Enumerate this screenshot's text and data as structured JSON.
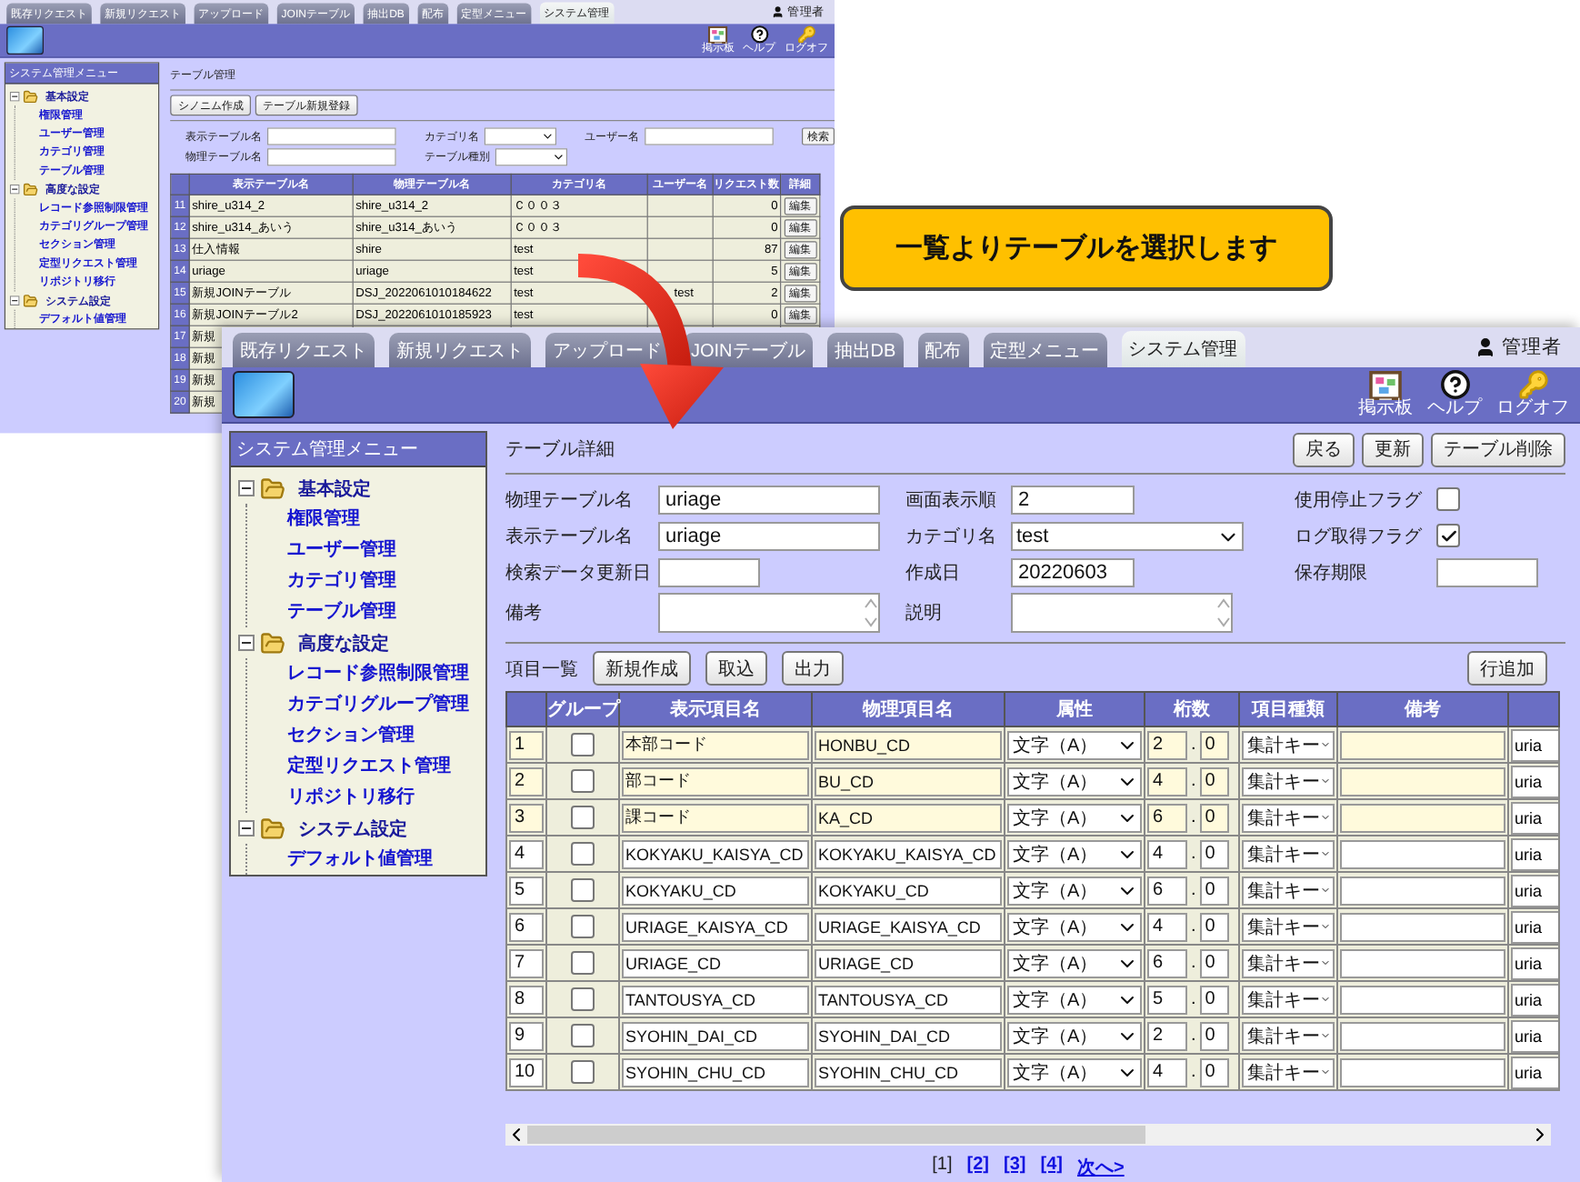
{
  "background_window": {
    "tabs": [
      {
        "label": "既存リクエスト",
        "selected": false
      },
      {
        "label": "新規リクエスト",
        "selected": false
      },
      {
        "label": "アップロード",
        "selected": false
      },
      {
        "label": "JOINテーブル",
        "selected": false
      },
      {
        "label": "抽出DB",
        "selected": false
      },
      {
        "label": "配布",
        "selected": false
      },
      {
        "label": "定型メニュー",
        "selected": false
      },
      {
        "label": "システム管理",
        "selected": true
      }
    ],
    "user": "管理者",
    "header_icons": [
      {
        "kind": "board",
        "label": "掲示板"
      },
      {
        "kind": "help",
        "label": "ヘルプ"
      },
      {
        "kind": "logoff",
        "label": "ログオフ"
      }
    ],
    "menu": {
      "title": "システム管理メニュー",
      "groups": [
        {
          "label": "基本設定",
          "expanded": true,
          "children": [
            {
              "label": "権限管理"
            },
            {
              "label": "ユーザー管理"
            },
            {
              "label": "カテゴリ管理"
            },
            {
              "label": "テーブル管理"
            }
          ]
        },
        {
          "label": "高度な設定",
          "expanded": true,
          "children": [
            {
              "label": "レコード参照制限管理"
            },
            {
              "label": "カテゴリグループ管理"
            },
            {
              "label": "セクション管理"
            },
            {
              "label": "定型リクエスト管理"
            },
            {
              "label": "リポジトリ移行"
            }
          ]
        },
        {
          "label": "システム設定",
          "expanded": true,
          "children": [
            {
              "label": "デフォルト値管理"
            }
          ]
        }
      ]
    },
    "page_title": "テーブル管理",
    "buttons": [
      "シノニム作成",
      "テーブル新規登録"
    ],
    "search_rows": [
      [
        {
          "label": "表示テーブル名",
          "kind": "text"
        },
        {
          "label": "カテゴリ名",
          "kind": "select"
        },
        {
          "label": "ユーザー名",
          "kind": "text"
        },
        {
          "label": "検索",
          "kind": "button"
        }
      ],
      [
        {
          "label": "物理テーブル名",
          "kind": "text"
        },
        {
          "label": "テーブル種別",
          "kind": "select"
        }
      ]
    ],
    "table": {
      "columns": [
        "表示テーブル名",
        "物理テーブル名",
        "カテゴリ名",
        "ユーザー名",
        "リクエスト数",
        "詳細"
      ],
      "rows": [
        {
          "no": "11",
          "display": "shire_u314_2",
          "physical": "shire_u314_2",
          "category": "Ｃ００３",
          "count": "0",
          "action": "編集"
        },
        {
          "no": "12",
          "display": "shire_u314_あいう",
          "physical": "shire_u314_あいう",
          "category": "Ｃ００３",
          "count": "0",
          "action": "編集"
        },
        {
          "no": "13",
          "display": "仕入情報",
          "physical": "shire",
          "category": "test",
          "count": "87",
          "action": "編集"
        },
        {
          "no": "14",
          "display": "uriage",
          "physical": "uriage",
          "category": "test",
          "count": "5",
          "action": "編集"
        },
        {
          "no": "15",
          "display": "新規JOINテーブル",
          "physical": "DSJ_2022061010184622",
          "category": "test",
          "user": "test",
          "count": "2",
          "action": "編集"
        },
        {
          "no": "16",
          "display": "新規JOINテーブル2",
          "physical": "DSJ_2022061010185923",
          "category": "test",
          "count": "0",
          "action": "編集"
        },
        {
          "no": "17",
          "display": "新規"
        },
        {
          "no": "18",
          "display": "新規"
        },
        {
          "no": "19",
          "display": "新規"
        },
        {
          "no": "20",
          "display": "新規"
        }
      ]
    }
  },
  "callout": "一覧よりテーブルを選択します",
  "detail_window": {
    "tabs": [
      {
        "label": "既存リクエスト",
        "selected": false
      },
      {
        "label": "新規リクエスト",
        "selected": false
      },
      {
        "label": "アップロード",
        "selected": false
      },
      {
        "label": "JOINテーブル",
        "selected": false
      },
      {
        "label": "抽出DB",
        "selected": false
      },
      {
        "label": "配布",
        "selected": false
      },
      {
        "label": "定型メニュー",
        "selected": false
      },
      {
        "label": "システム管理",
        "selected": true
      }
    ],
    "user": "管理者",
    "header_icons": [
      {
        "kind": "board",
        "label": "掲示板"
      },
      {
        "kind": "help",
        "label": "ヘルプ"
      },
      {
        "kind": "logoff",
        "label": "ログオフ"
      }
    ],
    "menu": {
      "title": "システム管理メニュー",
      "groups": [
        {
          "label": "基本設定",
          "expanded": true,
          "children": [
            {
              "label": "権限管理"
            },
            {
              "label": "ユーザー管理"
            },
            {
              "label": "カテゴリ管理"
            },
            {
              "label": "テーブル管理"
            }
          ]
        },
        {
          "label": "高度な設定",
          "expanded": true,
          "children": [
            {
              "label": "レコード参照制限管理"
            },
            {
              "label": "カテゴリグループ管理"
            },
            {
              "label": "セクション管理"
            },
            {
              "label": "定型リクエスト管理"
            },
            {
              "label": "リポジトリ移行"
            }
          ]
        },
        {
          "label": "システム設定",
          "expanded": true,
          "children": [
            {
              "label": "デフォルト値管理"
            }
          ]
        }
      ]
    },
    "page_title": "テーブル詳細",
    "actions": [
      "戻る",
      "更新",
      "テーブル削除"
    ],
    "form_rows": [
      [
        {
          "label": "物理テーブル名",
          "kind": "text",
          "value": "uriage"
        },
        {
          "label": "画面表示順",
          "kind": "short",
          "value": "2"
        },
        {
          "label": "使用停止フラグ",
          "kind": "checkbox",
          "checked": false
        }
      ],
      [
        {
          "label": "表示テーブル名",
          "kind": "text",
          "value": "uriage"
        },
        {
          "label": "カテゴリ名",
          "kind": "select",
          "value": "test"
        },
        {
          "label": "ログ取得フラグ",
          "kind": "checkbox",
          "checked": true
        }
      ],
      [
        {
          "label": "検索データ更新日",
          "kind": "short"
        },
        {
          "label": "作成日",
          "kind": "short",
          "value": "20220603"
        },
        {
          "label": "保存期限",
          "kind": "short"
        }
      ],
      [
        {
          "label": "備考",
          "kind": "textarea"
        },
        {
          "label": "説明",
          "kind": "textarea"
        }
      ]
    ],
    "list_title": "項目一覧",
    "list_buttons": [
      "新規作成",
      "取込",
      "出力"
    ],
    "add_row_button": "行追加",
    "columns": [
      "グループ",
      "表示項目名",
      "物理項目名",
      "属性",
      "桁数",
      "項目種類",
      "備考"
    ],
    "decimal_separator": ".",
    "rows": [
      {
        "no": "1",
        "group": false,
        "display": "本部コード",
        "physical": "HONBU_CD",
        "attribute": "文字（A）",
        "digits": "2",
        "decimals": "0",
        "item_type": "集計キー",
        "column_9": "uria",
        "highlighted": true
      },
      {
        "no": "2",
        "group": false,
        "display": "部コード",
        "physical": "BU_CD",
        "attribute": "文字（A）",
        "digits": "4",
        "decimals": "0",
        "item_type": "集計キー",
        "column_9": "uria",
        "highlighted": true
      },
      {
        "no": "3",
        "group": false,
        "display": "課コード",
        "physical": "KA_CD",
        "attribute": "文字（A）",
        "digits": "6",
        "decimals": "0",
        "item_type": "集計キー",
        "column_9": "uria",
        "highlighted": true
      },
      {
        "no": "4",
        "group": false,
        "display": "KOKYAKU_KAISYA_CD",
        "physical": "KOKYAKU_KAISYA_CD",
        "attribute": "文字（A）",
        "digits": "4",
        "decimals": "0",
        "item_type": "集計キー",
        "column_9": "uria",
        "highlighted": false
      },
      {
        "no": "5",
        "group": false,
        "display": "KOKYAKU_CD",
        "physical": "KOKYAKU_CD",
        "attribute": "文字（A）",
        "digits": "6",
        "decimals": "0",
        "item_type": "集計キー",
        "column_9": "uria",
        "highlighted": false
      },
      {
        "no": "6",
        "group": false,
        "display": "URIAGE_KAISYA_CD",
        "physical": "URIAGE_KAISYA_CD",
        "attribute": "文字（A）",
        "digits": "4",
        "decimals": "0",
        "item_type": "集計キー",
        "column_9": "uria",
        "highlighted": false
      },
      {
        "no": "7",
        "group": false,
        "display": "URIAGE_CD",
        "physical": "URIAGE_CD",
        "attribute": "文字（A）",
        "digits": "6",
        "decimals": "0",
        "item_type": "集計キー",
        "column_9": "uria",
        "highlighted": false
      },
      {
        "no": "8",
        "group": false,
        "display": "TANTOUSYA_CD",
        "physical": "TANTOUSYA_CD",
        "attribute": "文字（A）",
        "digits": "5",
        "decimals": "0",
        "item_type": "集計キー",
        "column_9": "uria",
        "highlighted": false
      },
      {
        "no": "9",
        "group": false,
        "display": "SYOHIN_DAI_CD",
        "physical": "SYOHIN_DAI_CD",
        "attribute": "文字（A）",
        "digits": "2",
        "decimals": "0",
        "item_type": "集計キー",
        "column_9": "uria",
        "highlighted": false
      },
      {
        "no": "10",
        "group": false,
        "display": "SYOHIN_CHU_CD",
        "physical": "SYOHIN_CHU_CD",
        "attribute": "文字（A）",
        "digits": "4",
        "decimals": "0",
        "item_type": "集計キー",
        "column_9": "uria",
        "highlighted": false
      }
    ],
    "pages": [
      {
        "label": "[1]",
        "selected": true
      },
      {
        "label": "[2]",
        "selected": false
      },
      {
        "label": "[3]",
        "selected": false
      },
      {
        "label": "[4]",
        "selected": false
      }
    ],
    "next": "次へ>"
  }
}
